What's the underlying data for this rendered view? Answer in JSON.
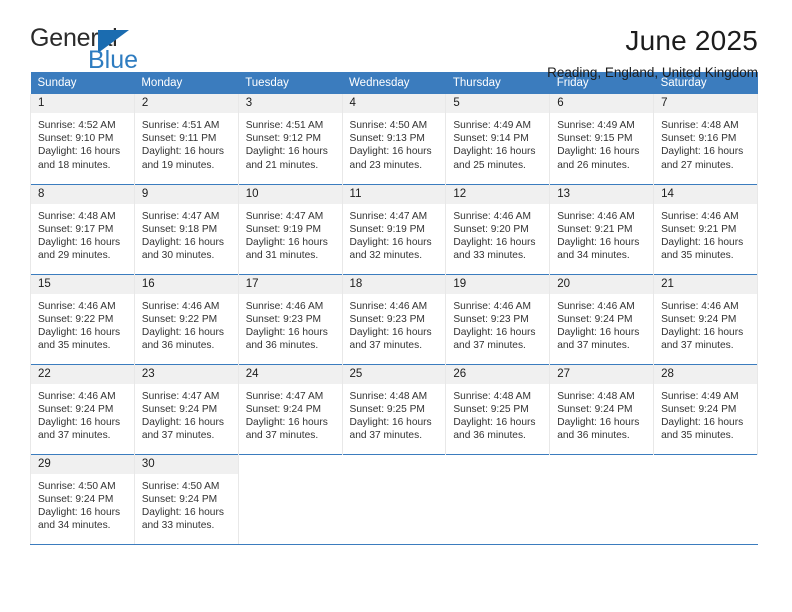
{
  "brand": {
    "logo_general": "General",
    "logo_blue": "Blue",
    "logo_triangle_icon": "triangle-icon",
    "accent_color": "#3b7cbe",
    "logo_text_color": "#2b2b2b",
    "logo_blue_color": "#2e7cc0"
  },
  "header": {
    "title": "June 2025",
    "subtitle": "Reading, England, United Kingdom"
  },
  "weekday_headers": [
    "Sunday",
    "Monday",
    "Tuesday",
    "Wednesday",
    "Thursday",
    "Friday",
    "Saturday"
  ],
  "weeks": [
    [
      {
        "day": "1",
        "sunrise": "Sunrise: 4:52 AM",
        "sunset": "Sunset: 9:10 PM",
        "daylight1": "Daylight: 16 hours",
        "daylight2": "and 18 minutes."
      },
      {
        "day": "2",
        "sunrise": "Sunrise: 4:51 AM",
        "sunset": "Sunset: 9:11 PM",
        "daylight1": "Daylight: 16 hours",
        "daylight2": "and 19 minutes."
      },
      {
        "day": "3",
        "sunrise": "Sunrise: 4:51 AM",
        "sunset": "Sunset: 9:12 PM",
        "daylight1": "Daylight: 16 hours",
        "daylight2": "and 21 minutes."
      },
      {
        "day": "4",
        "sunrise": "Sunrise: 4:50 AM",
        "sunset": "Sunset: 9:13 PM",
        "daylight1": "Daylight: 16 hours",
        "daylight2": "and 23 minutes."
      },
      {
        "day": "5",
        "sunrise": "Sunrise: 4:49 AM",
        "sunset": "Sunset: 9:14 PM",
        "daylight1": "Daylight: 16 hours",
        "daylight2": "and 25 minutes."
      },
      {
        "day": "6",
        "sunrise": "Sunrise: 4:49 AM",
        "sunset": "Sunset: 9:15 PM",
        "daylight1": "Daylight: 16 hours",
        "daylight2": "and 26 minutes."
      },
      {
        "day": "7",
        "sunrise": "Sunrise: 4:48 AM",
        "sunset": "Sunset: 9:16 PM",
        "daylight1": "Daylight: 16 hours",
        "daylight2": "and 27 minutes."
      }
    ],
    [
      {
        "day": "8",
        "sunrise": "Sunrise: 4:48 AM",
        "sunset": "Sunset: 9:17 PM",
        "daylight1": "Daylight: 16 hours",
        "daylight2": "and 29 minutes."
      },
      {
        "day": "9",
        "sunrise": "Sunrise: 4:47 AM",
        "sunset": "Sunset: 9:18 PM",
        "daylight1": "Daylight: 16 hours",
        "daylight2": "and 30 minutes."
      },
      {
        "day": "10",
        "sunrise": "Sunrise: 4:47 AM",
        "sunset": "Sunset: 9:19 PM",
        "daylight1": "Daylight: 16 hours",
        "daylight2": "and 31 minutes."
      },
      {
        "day": "11",
        "sunrise": "Sunrise: 4:47 AM",
        "sunset": "Sunset: 9:19 PM",
        "daylight1": "Daylight: 16 hours",
        "daylight2": "and 32 minutes."
      },
      {
        "day": "12",
        "sunrise": "Sunrise: 4:46 AM",
        "sunset": "Sunset: 9:20 PM",
        "daylight1": "Daylight: 16 hours",
        "daylight2": "and 33 minutes."
      },
      {
        "day": "13",
        "sunrise": "Sunrise: 4:46 AM",
        "sunset": "Sunset: 9:21 PM",
        "daylight1": "Daylight: 16 hours",
        "daylight2": "and 34 minutes."
      },
      {
        "day": "14",
        "sunrise": "Sunrise: 4:46 AM",
        "sunset": "Sunset: 9:21 PM",
        "daylight1": "Daylight: 16 hours",
        "daylight2": "and 35 minutes."
      }
    ],
    [
      {
        "day": "15",
        "sunrise": "Sunrise: 4:46 AM",
        "sunset": "Sunset: 9:22 PM",
        "daylight1": "Daylight: 16 hours",
        "daylight2": "and 35 minutes."
      },
      {
        "day": "16",
        "sunrise": "Sunrise: 4:46 AM",
        "sunset": "Sunset: 9:22 PM",
        "daylight1": "Daylight: 16 hours",
        "daylight2": "and 36 minutes."
      },
      {
        "day": "17",
        "sunrise": "Sunrise: 4:46 AM",
        "sunset": "Sunset: 9:23 PM",
        "daylight1": "Daylight: 16 hours",
        "daylight2": "and 36 minutes."
      },
      {
        "day": "18",
        "sunrise": "Sunrise: 4:46 AM",
        "sunset": "Sunset: 9:23 PM",
        "daylight1": "Daylight: 16 hours",
        "daylight2": "and 37 minutes."
      },
      {
        "day": "19",
        "sunrise": "Sunrise: 4:46 AM",
        "sunset": "Sunset: 9:23 PM",
        "daylight1": "Daylight: 16 hours",
        "daylight2": "and 37 minutes."
      },
      {
        "day": "20",
        "sunrise": "Sunrise: 4:46 AM",
        "sunset": "Sunset: 9:24 PM",
        "daylight1": "Daylight: 16 hours",
        "daylight2": "and 37 minutes."
      },
      {
        "day": "21",
        "sunrise": "Sunrise: 4:46 AM",
        "sunset": "Sunset: 9:24 PM",
        "daylight1": "Daylight: 16 hours",
        "daylight2": "and 37 minutes."
      }
    ],
    [
      {
        "day": "22",
        "sunrise": "Sunrise: 4:46 AM",
        "sunset": "Sunset: 9:24 PM",
        "daylight1": "Daylight: 16 hours",
        "daylight2": "and 37 minutes."
      },
      {
        "day": "23",
        "sunrise": "Sunrise: 4:47 AM",
        "sunset": "Sunset: 9:24 PM",
        "daylight1": "Daylight: 16 hours",
        "daylight2": "and 37 minutes."
      },
      {
        "day": "24",
        "sunrise": "Sunrise: 4:47 AM",
        "sunset": "Sunset: 9:24 PM",
        "daylight1": "Daylight: 16 hours",
        "daylight2": "and 37 minutes."
      },
      {
        "day": "25",
        "sunrise": "Sunrise: 4:48 AM",
        "sunset": "Sunset: 9:25 PM",
        "daylight1": "Daylight: 16 hours",
        "daylight2": "and 37 minutes."
      },
      {
        "day": "26",
        "sunrise": "Sunrise: 4:48 AM",
        "sunset": "Sunset: 9:25 PM",
        "daylight1": "Daylight: 16 hours",
        "daylight2": "and 36 minutes."
      },
      {
        "day": "27",
        "sunrise": "Sunrise: 4:48 AM",
        "sunset": "Sunset: 9:24 PM",
        "daylight1": "Daylight: 16 hours",
        "daylight2": "and 36 minutes."
      },
      {
        "day": "28",
        "sunrise": "Sunrise: 4:49 AM",
        "sunset": "Sunset: 9:24 PM",
        "daylight1": "Daylight: 16 hours",
        "daylight2": "and 35 minutes."
      }
    ],
    [
      {
        "day": "29",
        "sunrise": "Sunrise: 4:50 AM",
        "sunset": "Sunset: 9:24 PM",
        "daylight1": "Daylight: 16 hours",
        "daylight2": "and 34 minutes."
      },
      {
        "day": "30",
        "sunrise": "Sunrise: 4:50 AM",
        "sunset": "Sunset: 9:24 PM",
        "daylight1": "Daylight: 16 hours",
        "daylight2": "and 33 minutes."
      },
      {
        "day": "",
        "sunrise": "",
        "sunset": "",
        "daylight1": "",
        "daylight2": ""
      },
      {
        "day": "",
        "sunrise": "",
        "sunset": "",
        "daylight1": "",
        "daylight2": ""
      },
      {
        "day": "",
        "sunrise": "",
        "sunset": "",
        "daylight1": "",
        "daylight2": ""
      },
      {
        "day": "",
        "sunrise": "",
        "sunset": "",
        "daylight1": "",
        "daylight2": ""
      },
      {
        "day": "",
        "sunrise": "",
        "sunset": "",
        "daylight1": "",
        "daylight2": ""
      }
    ]
  ]
}
